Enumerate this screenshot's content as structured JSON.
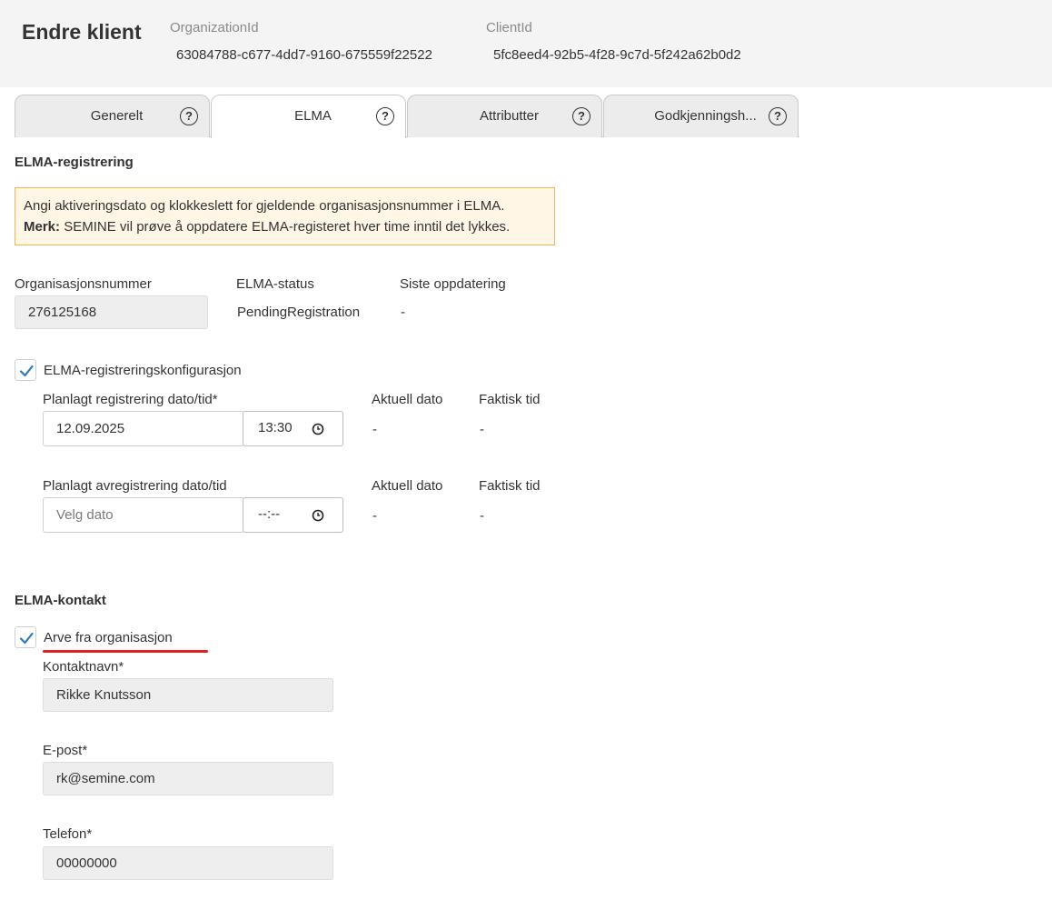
{
  "header": {
    "title": "Endre klient",
    "org_label": "OrganizationId",
    "org_value": "63084788-c677-4dd7-9160-675559f22522",
    "client_label": "ClientId",
    "client_value": "5fc8eed4-92b5-4f28-9c7d-5f242a62b0d2"
  },
  "tabs": [
    {
      "label": "Generelt",
      "help": "?"
    },
    {
      "label": "ELMA",
      "help": "?"
    },
    {
      "label": "Attributter",
      "help": "?"
    },
    {
      "label": "Godkjenningsh...",
      "help": "?"
    }
  ],
  "active_tab": "ELMA",
  "registration": {
    "section_title": "ELMA-registrering",
    "notice_line1": "Angi aktiveringsdato og klokkeslett for gjeldende organisasjonsnummer i ELMA.",
    "notice_bold": "Merk:",
    "notice_line2": "SEMINE vil prøve å oppdatere ELMA-registeret hver time inntil det lykkes.",
    "orgnr_label": "Organisasjonsnummer",
    "orgnr_value": "276125168",
    "status_label": "ELMA-status",
    "status_value": "PendingRegistration",
    "updated_label": "Siste oppdatering",
    "updated_value": "-"
  },
  "config": {
    "checkbox_label": "ELMA-registreringskonfigurasjon",
    "checked": true,
    "reg_label": "Planlagt registrering dato/tid*",
    "reg_date": "12.09.2025",
    "reg_time": "13:30",
    "reg_actual_date_label": "Aktuell dato",
    "reg_actual_date": "-",
    "reg_actual_time_label": "Faktisk tid",
    "reg_actual_time": "-",
    "dereg_label": "Planlagt avregistrering dato/tid",
    "dereg_date_placeholder": "Velg dato",
    "dereg_time": "--:--",
    "dereg_actual_date_label": "Aktuell dato",
    "dereg_actual_date": "-",
    "dereg_actual_time_label": "Faktisk tid",
    "dereg_actual_time": "-"
  },
  "contact": {
    "section_title": "ELMA-kontakt",
    "inherit_label": "Arve fra organisasjon",
    "inherit_checked": true,
    "name_label": "Kontaktnavn*",
    "name_value": "Rikke Knutsson",
    "email_label": "E-post*",
    "email_value": "rk@semine.com",
    "phone_label": "Telefon*",
    "phone_value": "00000000"
  },
  "colors": {
    "accent": "#2a7ab8",
    "notice_bg": "#fff6e6",
    "notice_border": "#f0b355",
    "underline": "#e02020"
  }
}
